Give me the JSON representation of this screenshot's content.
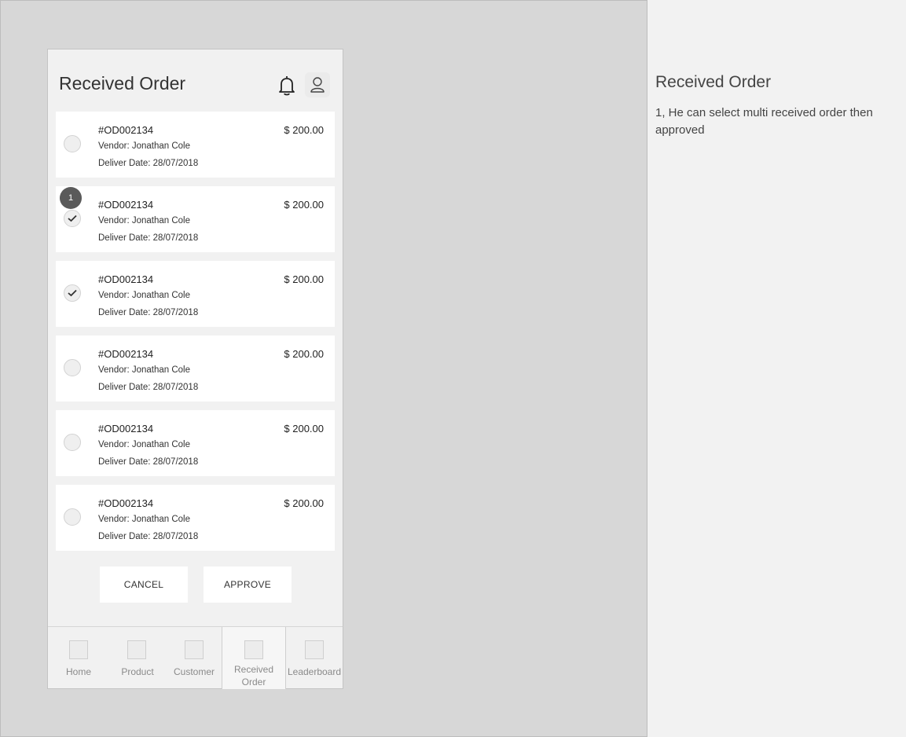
{
  "screen": {
    "title": "Received Order"
  },
  "orders": [
    {
      "id": "#OD002134",
      "vendor": "Vendor: Jonathan Cole",
      "date": "Deliver Date: 28/07/2018",
      "amount": "$ 200.00",
      "selected": false
    },
    {
      "id": "#OD002134",
      "vendor": "Vendor: Jonathan Cole",
      "date": "Deliver Date: 28/07/2018",
      "amount": "$ 200.00",
      "selected": true,
      "badge": "1"
    },
    {
      "id": "#OD002134",
      "vendor": "Vendor: Jonathan Cole",
      "date": "Deliver Date: 28/07/2018",
      "amount": "$ 200.00",
      "selected": true
    },
    {
      "id": "#OD002134",
      "vendor": "Vendor: Jonathan Cole",
      "date": "Deliver Date: 28/07/2018",
      "amount": "$ 200.00",
      "selected": false
    },
    {
      "id": "#OD002134",
      "vendor": "Vendor: Jonathan Cole",
      "date": "Deliver Date: 28/07/2018",
      "amount": "$ 200.00",
      "selected": false
    },
    {
      "id": "#OD002134",
      "vendor": "Vendor: Jonathan Cole",
      "date": "Deliver Date: 28/07/2018",
      "amount": "$ 200.00",
      "selected": false
    }
  ],
  "actions": {
    "cancel_label": "CANCEL",
    "approve_label": "APPROVE"
  },
  "tabs": [
    {
      "label": "Home",
      "icon": "home-icon"
    },
    {
      "label": "Product",
      "icon": "product-icon"
    },
    {
      "label": "Customer",
      "icon": "customer-icon"
    },
    {
      "label": "Received Order",
      "icon": "received-order-icon",
      "active": true
    },
    {
      "label": "Leaderboard",
      "icon": "leaderboard-icon"
    }
  ],
  "notes": {
    "title": "Received Order",
    "body": "1, He can select multi received order then approved"
  },
  "colors": {
    "canvas": "#d7d7d7",
    "notes_panel": "#f2f2f2",
    "phone_bg": "#f1f1f1",
    "card_bg": "#ffffff",
    "badge": "#5a5a5a"
  }
}
